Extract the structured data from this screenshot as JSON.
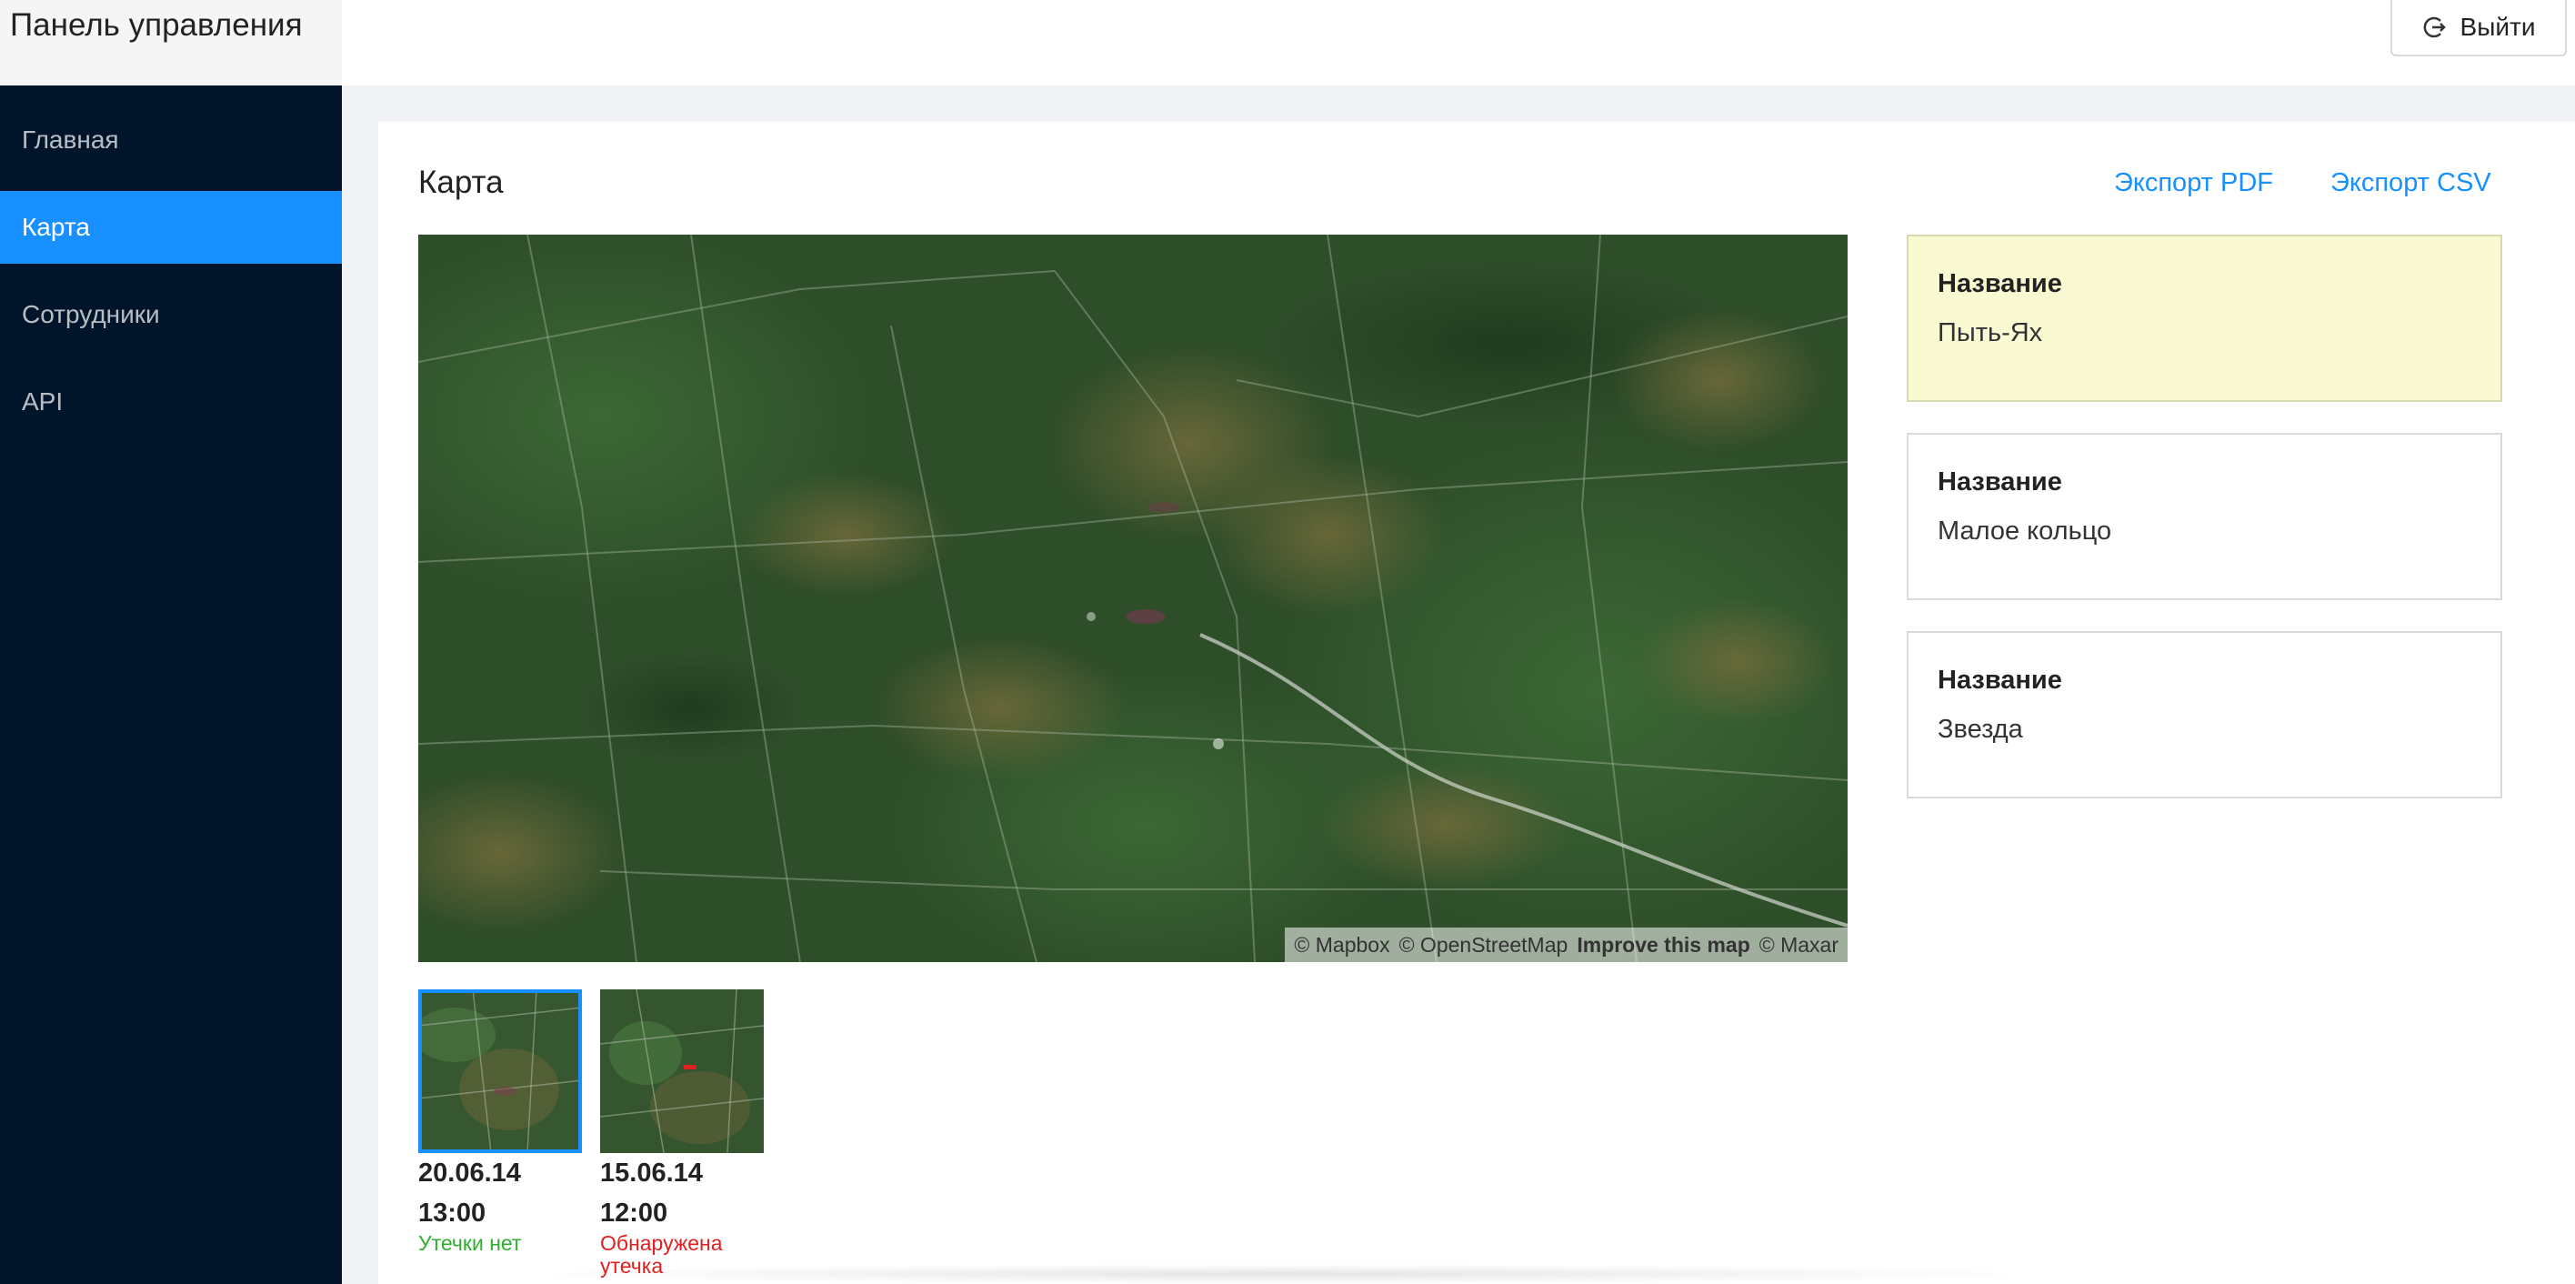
{
  "header": {
    "app_title": "Панель управления",
    "logout_label": "Выйти",
    "logout_icon": "logout-icon"
  },
  "sidebar": {
    "items": [
      {
        "label": "Главная",
        "active": false
      },
      {
        "label": "Карта",
        "active": true
      },
      {
        "label": "Сотрудники",
        "active": false
      },
      {
        "label": "API",
        "active": false
      }
    ]
  },
  "main": {
    "title": "Карта",
    "export_pdf": "Экспорт PDF",
    "export_csv": "Экспорт CSV"
  },
  "map": {
    "attribution": {
      "mapbox": "© Mapbox",
      "osm": "© OpenStreetMap",
      "improve": "Improve this map",
      "maxar": "© Maxar"
    }
  },
  "snapshots": [
    {
      "date": "20.06.14",
      "time": "13:00",
      "status": "Утечки нет",
      "status_type": "ok",
      "selected": true
    },
    {
      "date": "15.06.14",
      "time": "12:00",
      "status": "Обнаружена утечка",
      "status_type": "alert",
      "selected": false
    }
  ],
  "objects": [
    {
      "label": "Название",
      "value": "Пыть-Ях",
      "highlighted": true
    },
    {
      "label": "Название",
      "value": "Малое кольцо",
      "highlighted": false
    },
    {
      "label": "Название",
      "value": "Звезда",
      "highlighted": false
    }
  ],
  "colors": {
    "accent": "#1890ff",
    "sidebar_bg": "#001529",
    "ok": "#2fae2f",
    "alert": "#e02020",
    "highlight_card": "#fafad2"
  }
}
